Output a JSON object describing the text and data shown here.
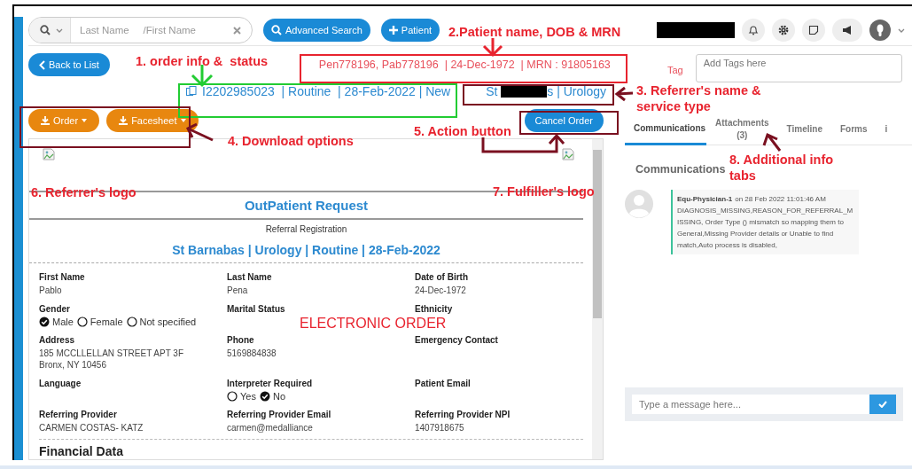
{
  "topbar": {
    "search": {
      "placeholder": "Last Name     /First Name"
    },
    "buttons": [
      {
        "label": "Advanced Search",
        "kind": "search"
      },
      {
        "label": "Patient",
        "kind": "add"
      }
    ]
  },
  "back_button": "Back to List",
  "patient_header": "Pen778196, Pab778196  | 24-Dec-1972  | MRN : 91805163",
  "order_info": "I2202985023  | Routine  | 28-Feb-2022 | New",
  "referrer": {
    "prefix": "St",
    "suffix": "s | Urology"
  },
  "download_buttons": [
    "Order",
    "Facesheet"
  ],
  "action_button": "Cancel Order",
  "tag": {
    "label": "Tag",
    "placeholder": "Add Tags here"
  },
  "tabs": [
    {
      "label": "Communications",
      "selected": true
    },
    {
      "label": "Attachments",
      "count": "(3)",
      "selected": false
    },
    {
      "label": "Timeline",
      "selected": false
    },
    {
      "label": "Forms",
      "selected": false
    },
    {
      "label": "i",
      "selected": false
    }
  ],
  "document": {
    "title": "OutPatient Request",
    "subtitle": "Referral Registration",
    "summary": "St Barnabas | Urology | Routine | 28-Feb-2022",
    "fields": [
      {
        "label": "First Name",
        "kind": "text",
        "lines": [
          "Pablo"
        ]
      },
      {
        "label": "Last Name",
        "kind": "text",
        "lines": [
          "Pena"
        ]
      },
      {
        "label": "Date of Birth",
        "kind": "text",
        "lines": [
          "24-Dec-1972"
        ]
      },
      {
        "label": "Gender",
        "kind": "radio",
        "options": [
          {
            "label": "Male",
            "selected": true
          },
          {
            "label": "Female",
            "selected": false
          },
          {
            "label": "Not specified",
            "selected": false
          }
        ]
      },
      {
        "label": "Marital Status",
        "kind": "text"
      },
      {
        "label": "Ethnicity",
        "kind": "text"
      },
      {
        "label": "Address",
        "kind": "text",
        "lines": [
          "185 MCCLLELLAN STREET APT 3F",
          "Bronx, NY 10456"
        ]
      },
      {
        "label": "Phone",
        "kind": "text",
        "lines": [
          "5169884838"
        ]
      },
      {
        "label": "Emergency Contact",
        "kind": "text"
      },
      {
        "label": "Language",
        "kind": "text"
      },
      {
        "label": "Interpreter Required",
        "kind": "radio",
        "options": [
          {
            "label": "Yes",
            "selected": false
          },
          {
            "label": "No",
            "selected": true
          }
        ]
      },
      {
        "label": "Patient Email",
        "kind": "text"
      },
      {
        "label": "Referring Provider",
        "kind": "text",
        "lines": [
          "CARMEN COSTAS- KATZ"
        ]
      },
      {
        "label": "Referring Provider Email",
        "kind": "text",
        "lines": [
          "carmen@medalliance"
        ]
      },
      {
        "label": "Referring Provider NPI",
        "kind": "text",
        "lines": [
          "1407918675"
        ]
      }
    ],
    "section": "Financial Data"
  },
  "communications": {
    "heading": "Communications",
    "messages": [
      {
        "author": "Equ-Physician-1",
        "meta": "on 28 Feb 2022 11:01:46 AM",
        "body": "DIAGNOSIS_MISSING,REASON_FOR_REFERRAL_MISSING, Order Type () mismatch so mapping them to General,Missing Provider details or Unable to find match,Auto process is disabled,"
      }
    ],
    "input": {
      "placeholder": "Type a message here..."
    }
  },
  "annotations": {
    "labels": [
      {
        "text": "1. order info &  status",
        "kind": "callout"
      },
      {
        "text": "2.Patient name, DOB & MRN",
        "kind": "callout"
      },
      {
        "text": "3. Referrer's name &\nservice type",
        "kind": "callout"
      },
      {
        "text": "4. Download options",
        "kind": "callout"
      },
      {
        "text": "5. Action button",
        "kind": "callout"
      },
      {
        "text": "6. Referrer's logo",
        "kind": "callout"
      },
      {
        "text": "7. Fulfiller's logo",
        "kind": "callout"
      },
      {
        "text": "8. Additional info\ntabs",
        "kind": "callout"
      },
      {
        "text": "ELECTRONIC ORDER",
        "kind": "stamp"
      }
    ],
    "boxes": [
      {
        "color": "#e8242f"
      },
      {
        "color": "#22cc33"
      },
      {
        "color": "#7a1020"
      },
      {
        "color": "#7a1020"
      },
      {
        "color": "#7a1020"
      }
    ],
    "arrows": [
      {
        "color": "#22cc33"
      },
      {
        "color": "#e8242f"
      },
      {
        "color": "#7a1020"
      },
      {
        "color": "#7a1020"
      },
      {
        "color": "#7a1020"
      },
      {
        "color": "#7a1020"
      }
    ]
  }
}
